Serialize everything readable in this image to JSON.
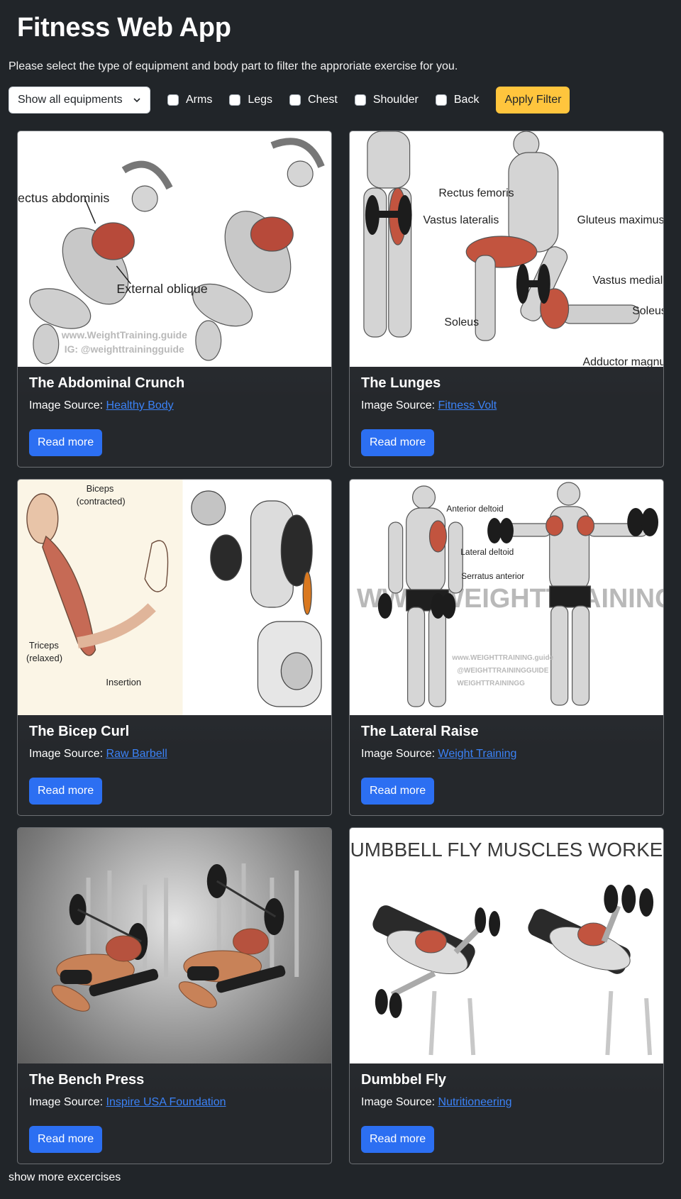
{
  "header": {
    "title": "Fitness Web App",
    "intro": "Please select the type of equipment and body part to filter the approriate exercise for you."
  },
  "filters": {
    "equipment_selected": "Show all equipments",
    "body_parts": [
      {
        "label": "Arms",
        "checked": false
      },
      {
        "label": "Legs",
        "checked": false
      },
      {
        "label": "Chest",
        "checked": false
      },
      {
        "label": "Shoulder",
        "checked": false
      },
      {
        "label": "Back",
        "checked": false
      }
    ],
    "apply_label": "Apply Filter"
  },
  "source_prefix": "Image Source:",
  "read_more_label": "Read more",
  "cards": [
    {
      "title": "The Abdominal Crunch",
      "source_name": "Healthy Body",
      "image_text": {
        "label1": "ectus abdominis",
        "label2": "External oblique",
        "wm1": "www.WeightTraining.guide",
        "wm2": "IG: @weighttrainingguide"
      }
    },
    {
      "title": "The Lunges",
      "source_name": "Fitness Volt",
      "image_text": {
        "label1": "Rectus femoris",
        "label2": "Vastus lateralis",
        "label3": "Gluteus maximus",
        "label4": "Vastus medialis",
        "label5": "Soleus",
        "label6": "Soleus",
        "label7": "Adductor magnus"
      }
    },
    {
      "title": "The Bicep Curl",
      "source_name": "Raw Barbell",
      "image_text": {
        "label1": "Biceps",
        "label2": "(contracted)",
        "label3": "Triceps",
        "label4": "(relaxed)",
        "label5": "Insertion"
      }
    },
    {
      "title": "The Lateral Raise",
      "source_name": "Weight Training",
      "image_text": {
        "label1": "Anterior deltoid",
        "label2": "Lateral deltoid",
        "label3": "Serratus anterior",
        "wm1": "WWW.WEIGHTTRAINING.GUIDE",
        "wm2": "www.WEIGHTTRAINING.guide",
        "wm3": "@WEIGHTTRAININGGUIDE",
        "wm4": "WEIGHTTRAININGG"
      }
    },
    {
      "title": "The Bench Press",
      "source_name": "Inspire USA Foundation",
      "image_text": {}
    },
    {
      "title": "Dumbbel Fly",
      "source_name": "Nutritioneering",
      "image_text": {
        "heading": "DUMBBELL FLY MUSCLES WORKED"
      }
    }
  ],
  "footer": {
    "show_more": "show more excercises"
  },
  "colors": {
    "page_bg": "#212529",
    "accent_yellow": "#ffc53d",
    "button_blue": "#2c6ff2",
    "link_blue": "#3b82f6"
  }
}
